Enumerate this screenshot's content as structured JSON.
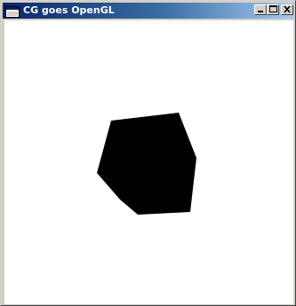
{
  "window": {
    "title": "CG goes OpenGL",
    "icon": "window-app-icon",
    "controls": {
      "minimize_icon": "minimize-icon",
      "maximize_icon": "maximize-icon",
      "close_icon": "close-icon"
    }
  },
  "scene": {
    "background": "#ffffff",
    "shape_color": "#000000",
    "shape": "cube-silhouette"
  },
  "colors": {
    "titlebar_start": "#0a246a",
    "titlebar_end": "#a6caf0",
    "window_face": "#d4d0c8"
  }
}
